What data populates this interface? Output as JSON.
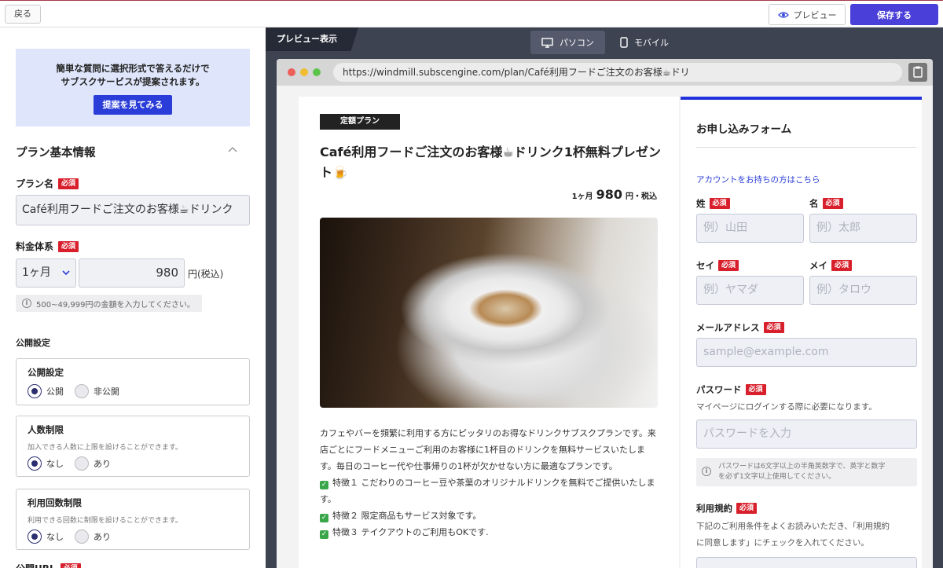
{
  "topbar": {
    "back_label": "戻る",
    "preview_label": "プレビュー",
    "save_label": "保存する"
  },
  "suggest": {
    "line1": "簡単な質問に選択形式で答えるだけで",
    "line2": "サブスクサービスが提案されます。",
    "button": "提案を見てみる"
  },
  "basic": {
    "section_title": "プラン基本情報",
    "required": "必須",
    "plan_name_label": "プラン名",
    "plan_name_value": "Café利用フードご注文のお客様☕ドリンク",
    "price_label": "料金体系",
    "period_value": "1ヶ月",
    "price_value": "980",
    "price_unit": "円(税込)",
    "price_note": "500~49,999円の金額を入力してください。"
  },
  "publish": {
    "heading": "公開設定",
    "card1_title": "公開設定",
    "card1_opt1": "公開",
    "card1_opt2": "非公開",
    "card2_title": "人数制限",
    "card2_desc": "加入できる人数に上限を設けることができます。",
    "card2_opt1": "なし",
    "card2_opt2": "あり",
    "card3_title": "利用回数制限",
    "card3_desc": "利用できる回数に制限を設けることができます。",
    "card3_opt1": "なし",
    "card3_opt2": "あり",
    "url_label": "公開URL"
  },
  "preview": {
    "tag": "プレビュー表示",
    "pc_label": "パソコン",
    "mobile_label": "モバイル",
    "url": "https://windmill.subscengine.com/plan/Café利用フードご注文のお客様☕ドリ"
  },
  "plan_page": {
    "tag": "定額プラン",
    "title": "Café利用フードご注文のお客様☕ドリンク1杯無料プレゼント🍺",
    "price_prefix": "1ヶ月",
    "price_num": "980",
    "price_suffix": "円・税込",
    "desc1": "カフェやバーを頻繁に利用する方にピッタリのお得なドリンクサブスクプランです。来店ごとにフードメニューご利用のお客様に1杯目のドリンクを無料サービスいたします。毎日のコーヒー代や仕事帰りの1杯が欠かせない方に最適なプランです。",
    "feature1": "特徴１ こだわりのコーヒー豆や茶葉のオリジナルドリンクを無料でご提供いたします。",
    "feature2": "特徴２ 限定商品もサービス対象です。",
    "feature3": "特徴３ テイクアウトのご利用もOKです."
  },
  "form": {
    "title": "お申し込みフォーム",
    "account_link": "アカウントをお持ちの方はこちら",
    "required": "必須",
    "last_name_label": "姓",
    "last_name_ph": "例）山田",
    "first_name_label": "名",
    "first_name_ph": "例）太郎",
    "last_kana_label": "セイ",
    "last_kana_ph": "例）ヤマダ",
    "first_kana_label": "メイ",
    "first_kana_ph": "例）タロウ",
    "email_label": "メールアドレス",
    "email_ph": "sample@example.com",
    "password_label": "パスワード",
    "password_sub": "マイページにログインする際に必要になります。",
    "password_ph": "パスワードを入力",
    "password_note1": "パスワードは6文字以上の半角英数字で、英字と数字",
    "password_note2": "を必ず1文字以上使用してください。",
    "terms_label": "利用規約",
    "terms_sub1": "下記のご利用条件をよくお読みいただき、「利用規約",
    "terms_sub2": "に同意します」にチェックを入れてください。"
  }
}
